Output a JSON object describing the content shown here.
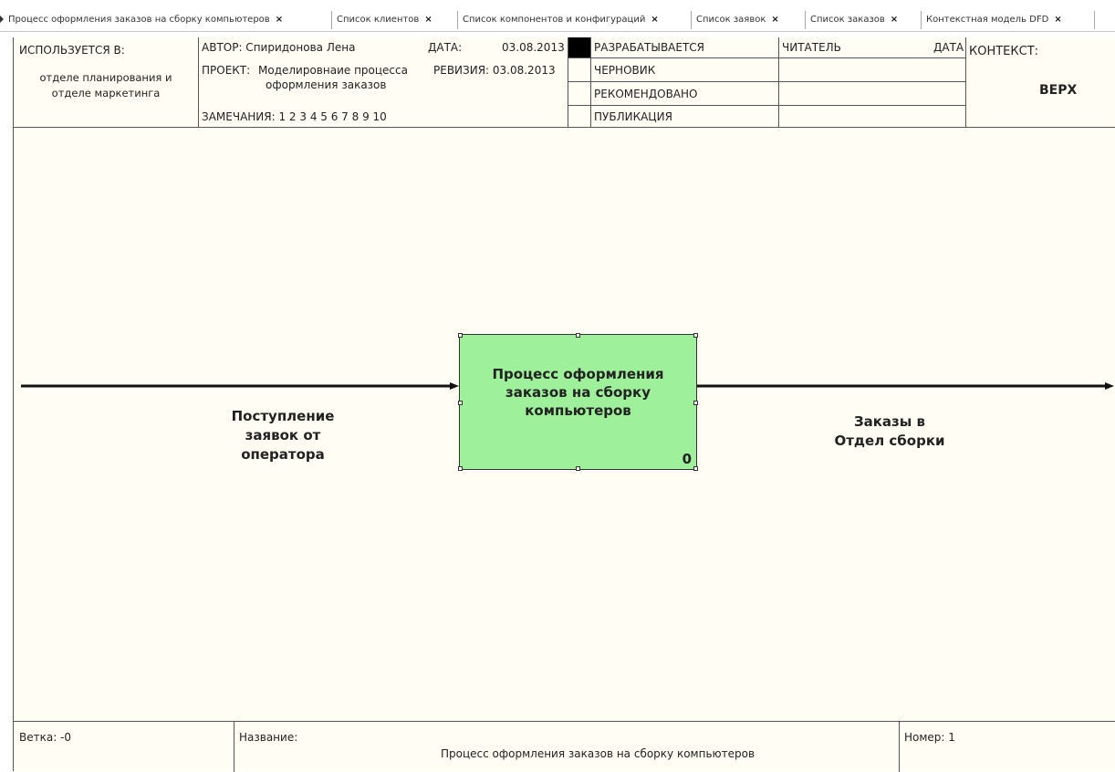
{
  "tabs": [
    {
      "label": "Процесс оформления заказов на сборку компьютеров"
    },
    {
      "label": "Список клиентов"
    },
    {
      "label": "Список компонентов и конфигураций"
    },
    {
      "label": "Список заявок"
    },
    {
      "label": "Список заказов"
    },
    {
      "label": "Контекстная модель DFD"
    }
  ],
  "tab_close": "×",
  "header": {
    "used_in_label": "ИСПОЛЬЗУЕТСЯ В:",
    "used_in_value": [
      "отделе планирования и",
      "отделе маркетинга"
    ],
    "author": "АВТОР: Спиридонова Лена",
    "date_label": "ДАТА:",
    "date_value": "03.08.2013",
    "project_label": "ПРОЕКТ:",
    "project_value": [
      "Моделировнаие процесса",
      "оформления заказов"
    ],
    "revision": "РЕВИЗИЯ: 03.08.2013",
    "notes": "ЗАМЕЧАНИЯ: 1 2 3 4 5 6 7 8 9 10",
    "status": [
      "РАЗРАБАТЫВАЕТСЯ",
      "ЧЕРНОВИК",
      "РЕКОМЕНДОВАНО",
      "ПУБЛИКАЦИЯ"
    ],
    "reader_label": "ЧИТАТЕЛЬ",
    "reader_date_label": "ДАТА",
    "context_label": "КОНТЕКСТ:",
    "context_value": "ВЕРХ"
  },
  "diagram": {
    "process": {
      "lines": [
        "Процесс оформления",
        "заказов на сборку",
        "компьютеров"
      ],
      "number": "0",
      "fill": "#9ef09a"
    },
    "input_arrow": {
      "lines": [
        "Поступление",
        "заявок от",
        "оператора"
      ]
    },
    "output_arrow": {
      "lines": [
        "Заказы в",
        "Отдел сборки"
      ]
    }
  },
  "footer": {
    "node": "Ветка: -0",
    "title_label": "Название:",
    "title_value": "Процесс оформления заказов на сборку компьютеров",
    "number": "Номер: 1"
  }
}
